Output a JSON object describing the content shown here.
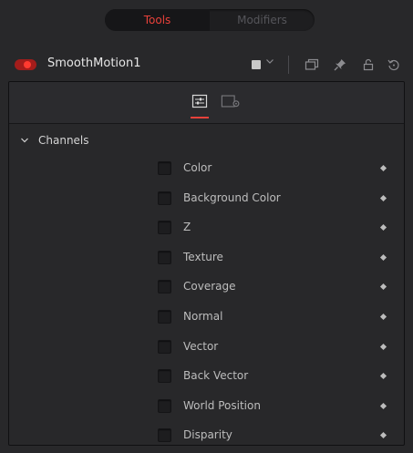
{
  "tabs": [
    {
      "label": "Tools",
      "active": true
    },
    {
      "label": "Modifiers",
      "active": false
    }
  ],
  "tool": {
    "name": "SmoothMotion1",
    "enabled": true,
    "color_chip": "#c8c8c8",
    "header_icons": [
      "window-icon",
      "pin-icon",
      "lock-icon",
      "reset-icon"
    ]
  },
  "panel": {
    "tabs": [
      {
        "icon": "sliders-icon",
        "active": true
      },
      {
        "icon": "settings-panel-icon",
        "active": false
      }
    ],
    "section": {
      "label": "Channels",
      "expanded": true
    },
    "channels": [
      {
        "label": "Color",
        "checked": false
      },
      {
        "label": "Background Color",
        "checked": false
      },
      {
        "label": "Z",
        "checked": false
      },
      {
        "label": "Texture",
        "checked": false
      },
      {
        "label": "Coverage",
        "checked": false
      },
      {
        "label": "Normal",
        "checked": false
      },
      {
        "label": "Vector",
        "checked": false
      },
      {
        "label": "Back Vector",
        "checked": false
      },
      {
        "label": "World Position",
        "checked": false
      },
      {
        "label": "Disparity",
        "checked": false
      }
    ]
  },
  "colors": {
    "accent": "#e8413a",
    "background": "#28282a",
    "text": "#bdbdbd"
  }
}
